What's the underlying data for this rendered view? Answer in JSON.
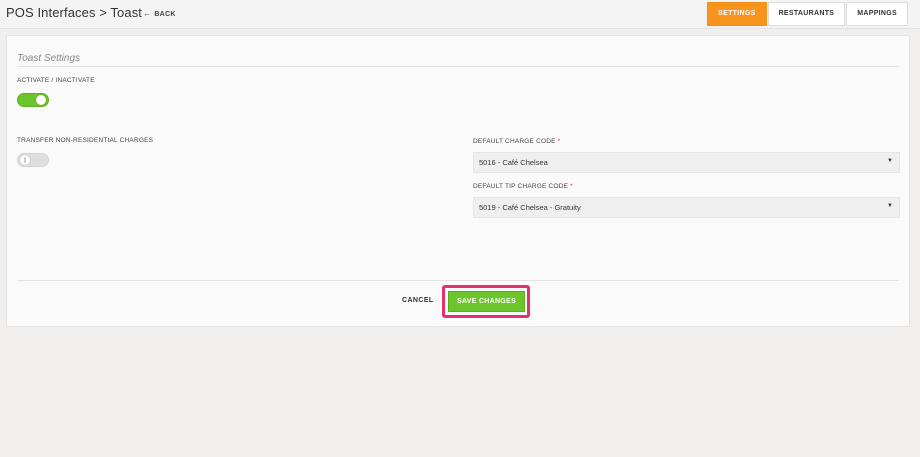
{
  "header": {
    "title": "POS Interfaces > Toast",
    "back_label": "BACK",
    "back_arrow": "←"
  },
  "tabs": [
    {
      "label": "SETTINGS",
      "active": true
    },
    {
      "label": "RESTAURANTS",
      "active": false
    },
    {
      "label": "MAPPINGS",
      "active": false
    }
  ],
  "settings": {
    "section_title": "Toast Settings",
    "activate": {
      "label": "ACTIVATE / INACTIVATE",
      "enabled": true
    },
    "transfer": {
      "label": "TRANSFER NON-RESIDENTIAL CHARGES",
      "enabled": false
    },
    "default_charge_code": {
      "label": "DEFAULT CHARGE CODE",
      "required_mark": "*",
      "value": "5016 - Café Chelsea"
    },
    "default_tip_charge_code": {
      "label": "DEFAULT TIP CHARGE CODE",
      "required_mark": "*",
      "value": "5019 - Café Chelsea - Gratuity"
    }
  },
  "actions": {
    "cancel_label": "CANCEL",
    "save_label": "SAVE CHANGES"
  },
  "colors": {
    "accent_orange": "#f7941d",
    "toggle_on": "#6dc42b",
    "save_green": "#6cc52a",
    "highlight_pink": "#e5306f"
  },
  "icons": {
    "back": "arrow-left-icon",
    "select_caret": "caret-down-icon"
  }
}
